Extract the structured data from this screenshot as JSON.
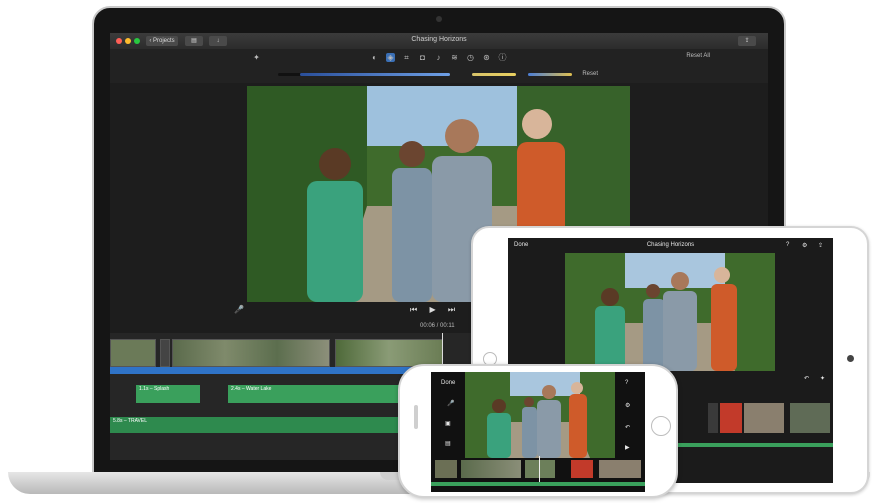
{
  "laptop": {
    "window_title": "Chasing Horizons",
    "back_button": "Projects",
    "reset_all": "Reset All",
    "reset": "Reset",
    "timecode": "00:06 / 00:11",
    "clip_labels": [
      "1.1s – Splash",
      "2.4s – Water Lake",
      "5.8s – TRAVEL"
    ],
    "tool_icons": [
      "magic-wand-icon",
      "color-balance-icon",
      "color-correction-icon",
      "crop-icon",
      "stabilization-icon",
      "volume-icon",
      "noise-reduction-icon",
      "speed-icon",
      "filter-icon",
      "info-icon"
    ],
    "colors": {
      "accent_blue": "#2f73c7",
      "audio_green": "#3aa05c",
      "close": "#ff5f57",
      "minimize": "#febc2e",
      "zoom": "#28c840"
    }
  },
  "ipad": {
    "title": "Chasing Horizons",
    "done": "Done"
  },
  "iphone": {
    "done": "Done"
  }
}
